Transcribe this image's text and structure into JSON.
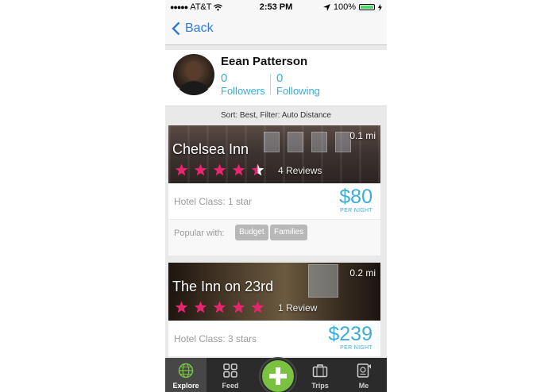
{
  "status_bar": {
    "carrier": "AT&T",
    "time": "2:53 PM",
    "battery": "100%",
    "battery_level": 1.0
  },
  "nav": {
    "back_label": "Back"
  },
  "profile": {
    "name": "Eean Patterson",
    "followers_count": "0",
    "followers_label": "Followers",
    "following_count": "0",
    "following_label": "Following"
  },
  "sort_text": "Sort: Best, Filter: Auto Distance",
  "hotels": [
    {
      "name": "Chelsea Inn",
      "distance": "0.1 mi",
      "rating": 4.5,
      "reviews": "4 Reviews",
      "hotel_class": "Hotel Class: 1 star",
      "price": "$80",
      "per_night": "PER NIGHT",
      "popular_label": "Popular with:",
      "tags": [
        "Budget",
        "Families"
      ]
    },
    {
      "name": "The Inn on 23rd",
      "distance": "0.2 mi",
      "rating": 5,
      "reviews": "1 Review",
      "hotel_class": "Hotel Class: 3 stars",
      "price": "$239",
      "per_night": "PER NIGHT"
    }
  ],
  "tabs": [
    {
      "label": "Explore",
      "icon": "globe-icon",
      "active": true
    },
    {
      "label": "Feed",
      "icon": "grid-icon",
      "active": false
    },
    {
      "label": "",
      "icon": "plus-icon",
      "active": false
    },
    {
      "label": "Trips",
      "icon": "suitcase-icon",
      "active": false
    },
    {
      "label": "Me",
      "icon": "passport-icon",
      "active": false
    }
  ],
  "colors": {
    "accent_blue": "#3aaed8",
    "link_blue": "#2f7bd6",
    "star_pink": "#e8246f",
    "plus_green": "#7ac142",
    "tabbar_bg": "#2b2b2b"
  }
}
